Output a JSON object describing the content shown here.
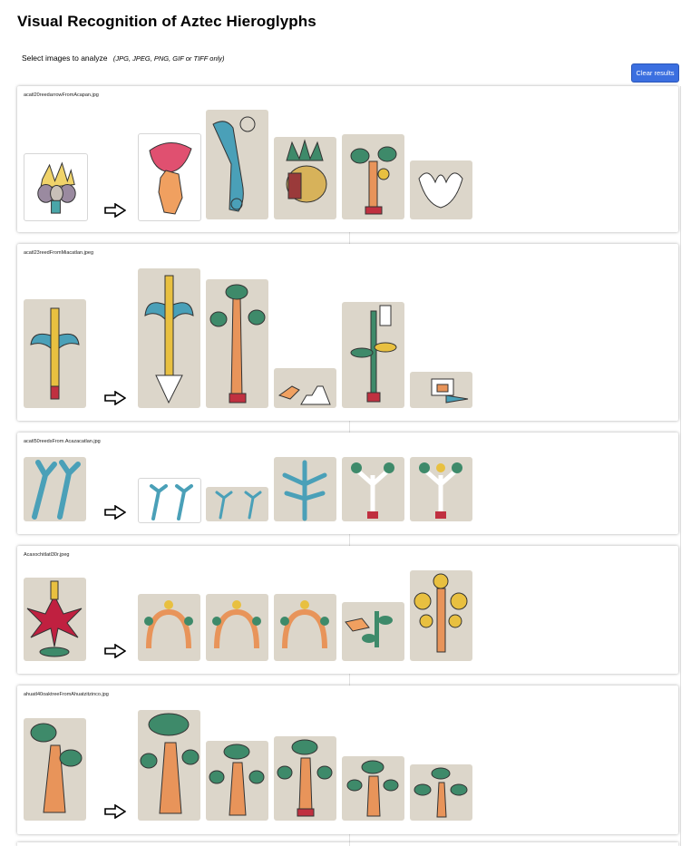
{
  "page": {
    "title": "Visual Recognition of Aztec Hieroglyphs",
    "upload_label": "Select images to analyze",
    "upload_hint": "(JPG, JPEG, PNG, GIF or TIFF only)",
    "clear_button": "Clear results"
  },
  "results": [
    {
      "filename": "acatl20reedarrowFromAcapan.jpg"
    },
    {
      "filename": "acatl23reedFromMiacatlan.jpeg"
    },
    {
      "filename": "acatl50reedsFrom.Acazacatlan.jpg"
    },
    {
      "filename": "Acaxochitlatl30r.jpeg"
    },
    {
      "filename": "ahuatl40oaktreeFromAhuatzitzinco.jpg"
    }
  ],
  "icons": {
    "arrow": "right-arrow-icon"
  }
}
